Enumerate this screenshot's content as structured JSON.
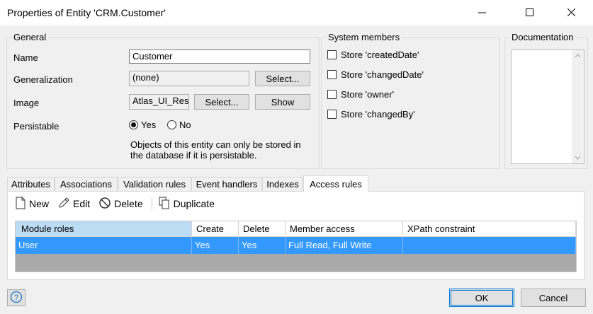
{
  "window": {
    "title": "Properties of Entity 'CRM.Customer'"
  },
  "general": {
    "legend": "General",
    "name_label": "Name",
    "name_value": "Customer",
    "generalization_label": "Generalization",
    "generalization_value": "(none)",
    "generalization_select": "Select...",
    "image_label": "Image",
    "image_value": "Atlas_UI_Res",
    "image_select": "Select...",
    "image_show": "Show",
    "persistable_label": "Persistable",
    "persistable_yes": "Yes",
    "persistable_no": "No",
    "persistable_selected": "Yes",
    "persistable_note_1": "Objects of this entity can only be stored in",
    "persistable_note_2": "the database if it is persistable."
  },
  "system_members": {
    "legend": "System members",
    "items": [
      "Store 'createdDate'",
      "Store 'changedDate'",
      "Store 'owner'",
      "Store 'changedBy'"
    ]
  },
  "documentation": {
    "legend": "Documentation"
  },
  "tabs": [
    "Attributes",
    "Associations",
    "Validation rules",
    "Event handlers",
    "Indexes",
    "Access rules"
  ],
  "active_tab": "Access rules",
  "toolbar": {
    "new": "New",
    "edit": "Edit",
    "delete": "Delete",
    "duplicate": "Duplicate"
  },
  "table": {
    "headers": [
      "Module roles",
      "Create",
      "Delete",
      "Member access",
      "XPath constraint"
    ],
    "rows": [
      [
        "User",
        "Yes",
        "Yes",
        "Full Read, Full Write",
        ""
      ]
    ]
  },
  "footer": {
    "ok": "OK",
    "cancel": "Cancel"
  }
}
